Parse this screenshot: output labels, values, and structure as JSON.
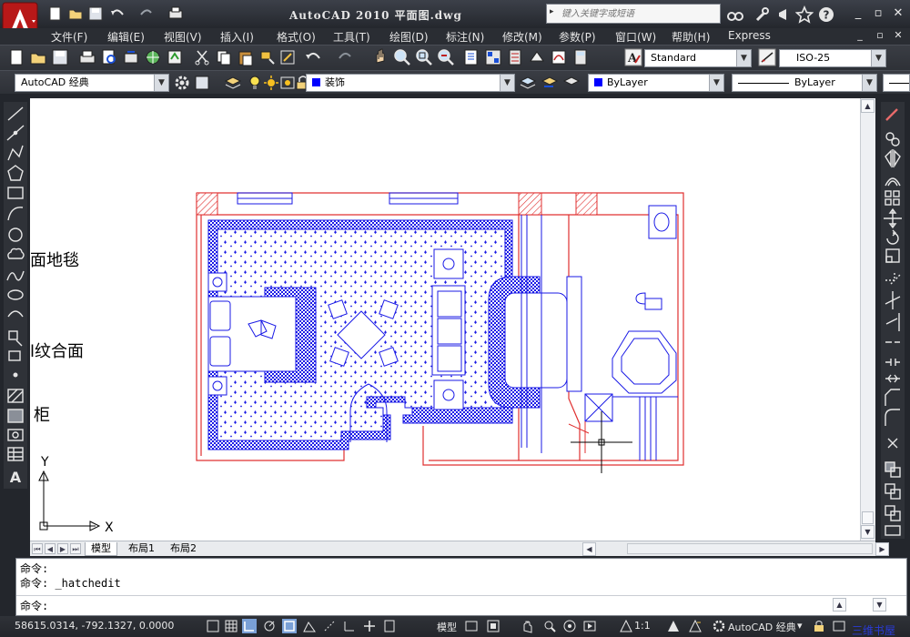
{
  "window": {
    "title": "AutoCAD 2010   平面图.dwg",
    "search_placeholder": "键入关键字或短语"
  },
  "menu": [
    "文件(F)",
    "编辑(E)",
    "视图(V)",
    "插入(I)",
    "格式(O)",
    "工具(T)",
    "绘图(D)",
    "标注(N)",
    "修改(M)",
    "参数(P)",
    "窗口(W)",
    "帮助(H)",
    "Express"
  ],
  "toolbar": {
    "text_style": "Standard",
    "dim_style": "ISO-25",
    "workspace": "AutoCAD 经典",
    "layer": "装饰",
    "color": "ByLayer",
    "linetype": "ByLayer"
  },
  "drawing": {
    "side_labels": [
      "面地毯",
      "l纹合面",
      "柜"
    ],
    "axis": {
      "x": "X",
      "y": "Y"
    }
  },
  "tabs": [
    "模型",
    "布局1",
    "布局2"
  ],
  "command": {
    "lines": [
      "命令:",
      "命令:  _hatchedit"
    ],
    "prompt": "命令:"
  },
  "status": {
    "coords": "58615.0314, -792.1327, 0.0000",
    "model_label": "模型",
    "scale": "1:1",
    "workspace": "AutoCAD 经典"
  },
  "watermark": "三维书屋",
  "colors": {
    "line_red": "#e03030",
    "line_blue": "#1a1ae6",
    "ui_dark": "#2b2e34"
  }
}
